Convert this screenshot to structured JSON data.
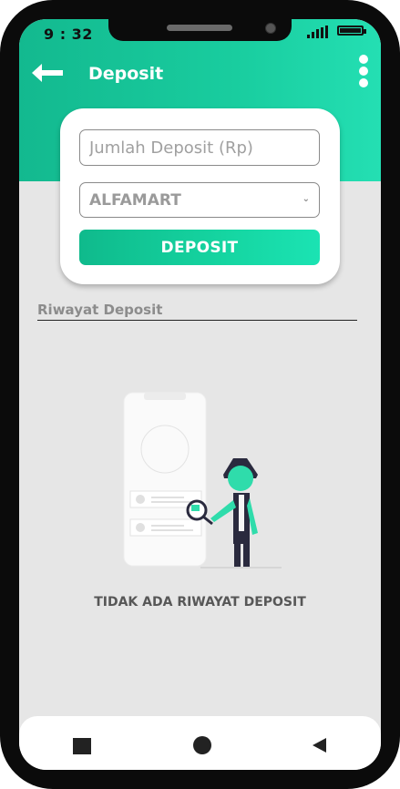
{
  "status_bar": {
    "time": "9 : 32"
  },
  "header": {
    "title": "Deposit"
  },
  "form": {
    "amount_placeholder": "Jumlah Deposit (Rp)",
    "payment_method": "ALFAMART",
    "deposit_button": "DEPOSIT"
  },
  "history": {
    "label": "Riwayat Deposit",
    "empty_text": "TIDAK ADA RIWAYAT DEPOSIT"
  },
  "icons": {
    "back": "arrow-left-icon",
    "menu": "more-vertical-icon",
    "nav_recents": "square-icon",
    "nav_home": "circle-icon",
    "nav_back": "triangle-back-icon"
  },
  "colors": {
    "accent": "#19cd9f",
    "accent_light": "#24dfb3"
  }
}
